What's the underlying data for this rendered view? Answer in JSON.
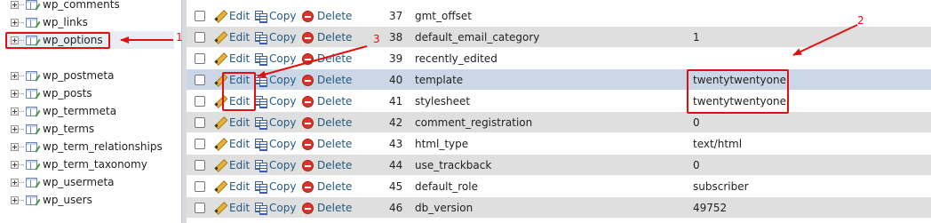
{
  "sidebar": {
    "items": [
      {
        "label": "wp_comments"
      },
      {
        "label": "wp_links"
      },
      {
        "label": "wp_options"
      },
      {
        "label": "wp_postmeta"
      },
      {
        "label": "wp_posts"
      },
      {
        "label": "wp_termmeta"
      },
      {
        "label": "wp_terms"
      },
      {
        "label": "wp_term_relationships"
      },
      {
        "label": "wp_term_taxonomy"
      },
      {
        "label": "wp_usermeta"
      },
      {
        "label": "wp_users"
      }
    ]
  },
  "actions": {
    "edit": "Edit",
    "copy": "Copy",
    "delete": "Delete"
  },
  "rows": [
    {
      "id": "37",
      "name": "gmt_offset",
      "value": ""
    },
    {
      "id": "38",
      "name": "default_email_category",
      "value": "1"
    },
    {
      "id": "39",
      "name": "recently_edited",
      "value": ""
    },
    {
      "id": "40",
      "name": "template",
      "value": "twentytwentyone"
    },
    {
      "id": "41",
      "name": "stylesheet",
      "value": "twentytwentyone"
    },
    {
      "id": "42",
      "name": "comment_registration",
      "value": "0"
    },
    {
      "id": "43",
      "name": "html_type",
      "value": "text/html"
    },
    {
      "id": "44",
      "name": "use_trackback",
      "value": "0"
    },
    {
      "id": "45",
      "name": "default_role",
      "value": "subscriber"
    },
    {
      "id": "46",
      "name": "db_version",
      "value": "49752"
    }
  ],
  "annotations": {
    "one": "1",
    "two": "2",
    "three": "3",
    "color": "#e01010"
  }
}
